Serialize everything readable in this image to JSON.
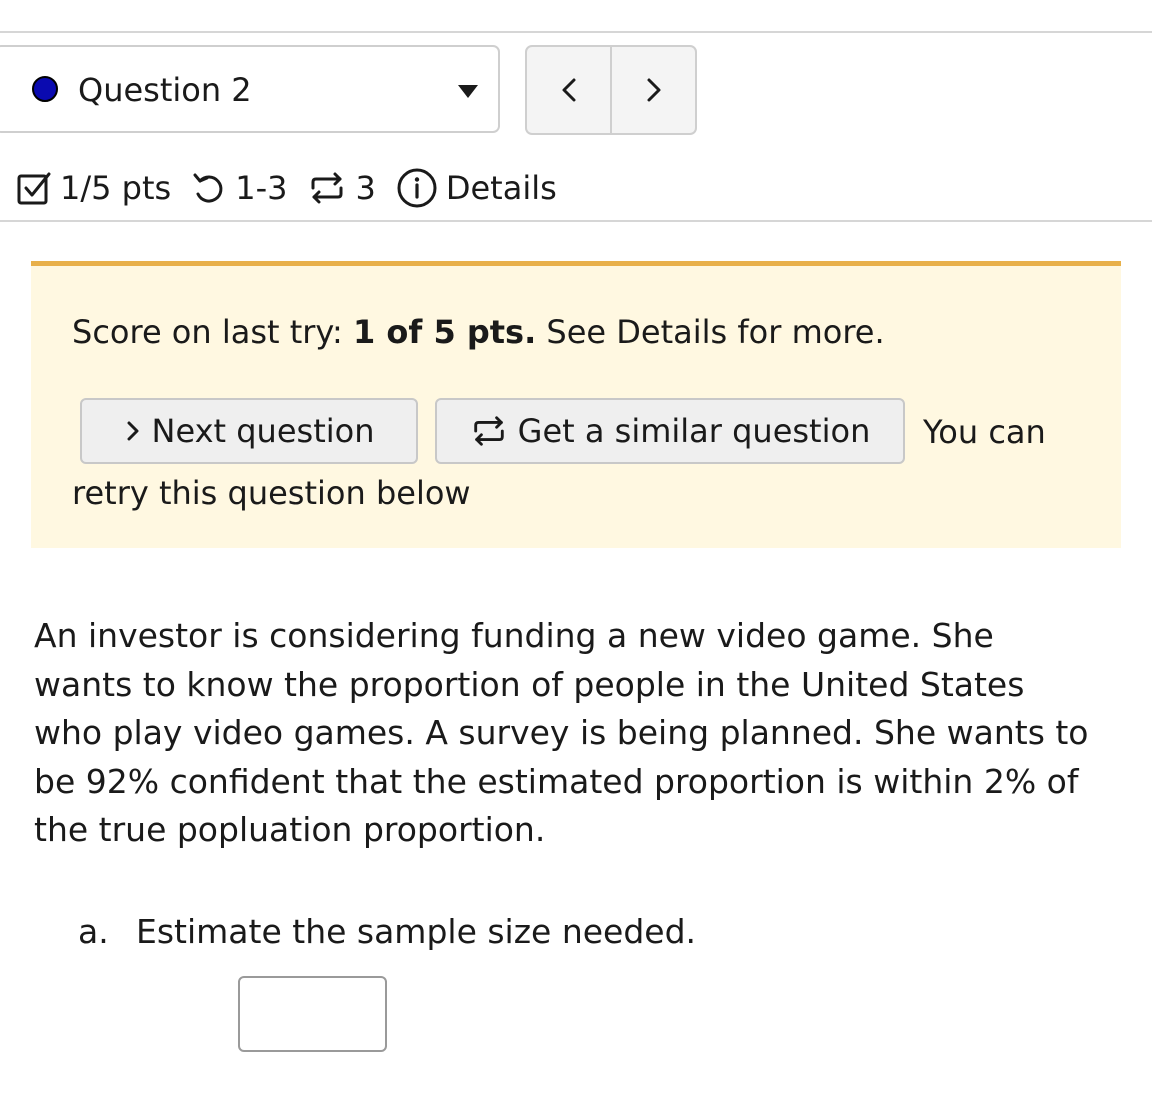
{
  "question_nav": {
    "label": "Question 2",
    "status_color": "#0a0ab0",
    "dropdown_icon": "caret-down-icon",
    "prev_icon": "chevron-left-icon",
    "next_icon": "chevron-right-icon"
  },
  "meta": {
    "points": "1/5 pts",
    "attempts": "1-3",
    "versions": "3",
    "details_label": "Details"
  },
  "notice": {
    "accent_color": "#e8b04a",
    "score_prefix": "Score on last try:",
    "score_value": "1 of 5 pts.",
    "score_suffix": "See Details for more.",
    "next_button": "Next question",
    "similar_button": "Get a similar question",
    "retry_text_1": "You can",
    "retry_text_2": "retry this question below"
  },
  "problem": {
    "lines": [
      "An investor is considering funding a new video game. She",
      "wants to know the proportion of people in the United States",
      "who play video games. A survey is being planned. She wants to",
      "be 92% confident that the estimated proportion is within 2% of",
      "the true popluation proportion."
    ],
    "part_a_letter": "a.",
    "part_a_prompt": "Estimate the sample size needed.",
    "part_a_value": ""
  }
}
